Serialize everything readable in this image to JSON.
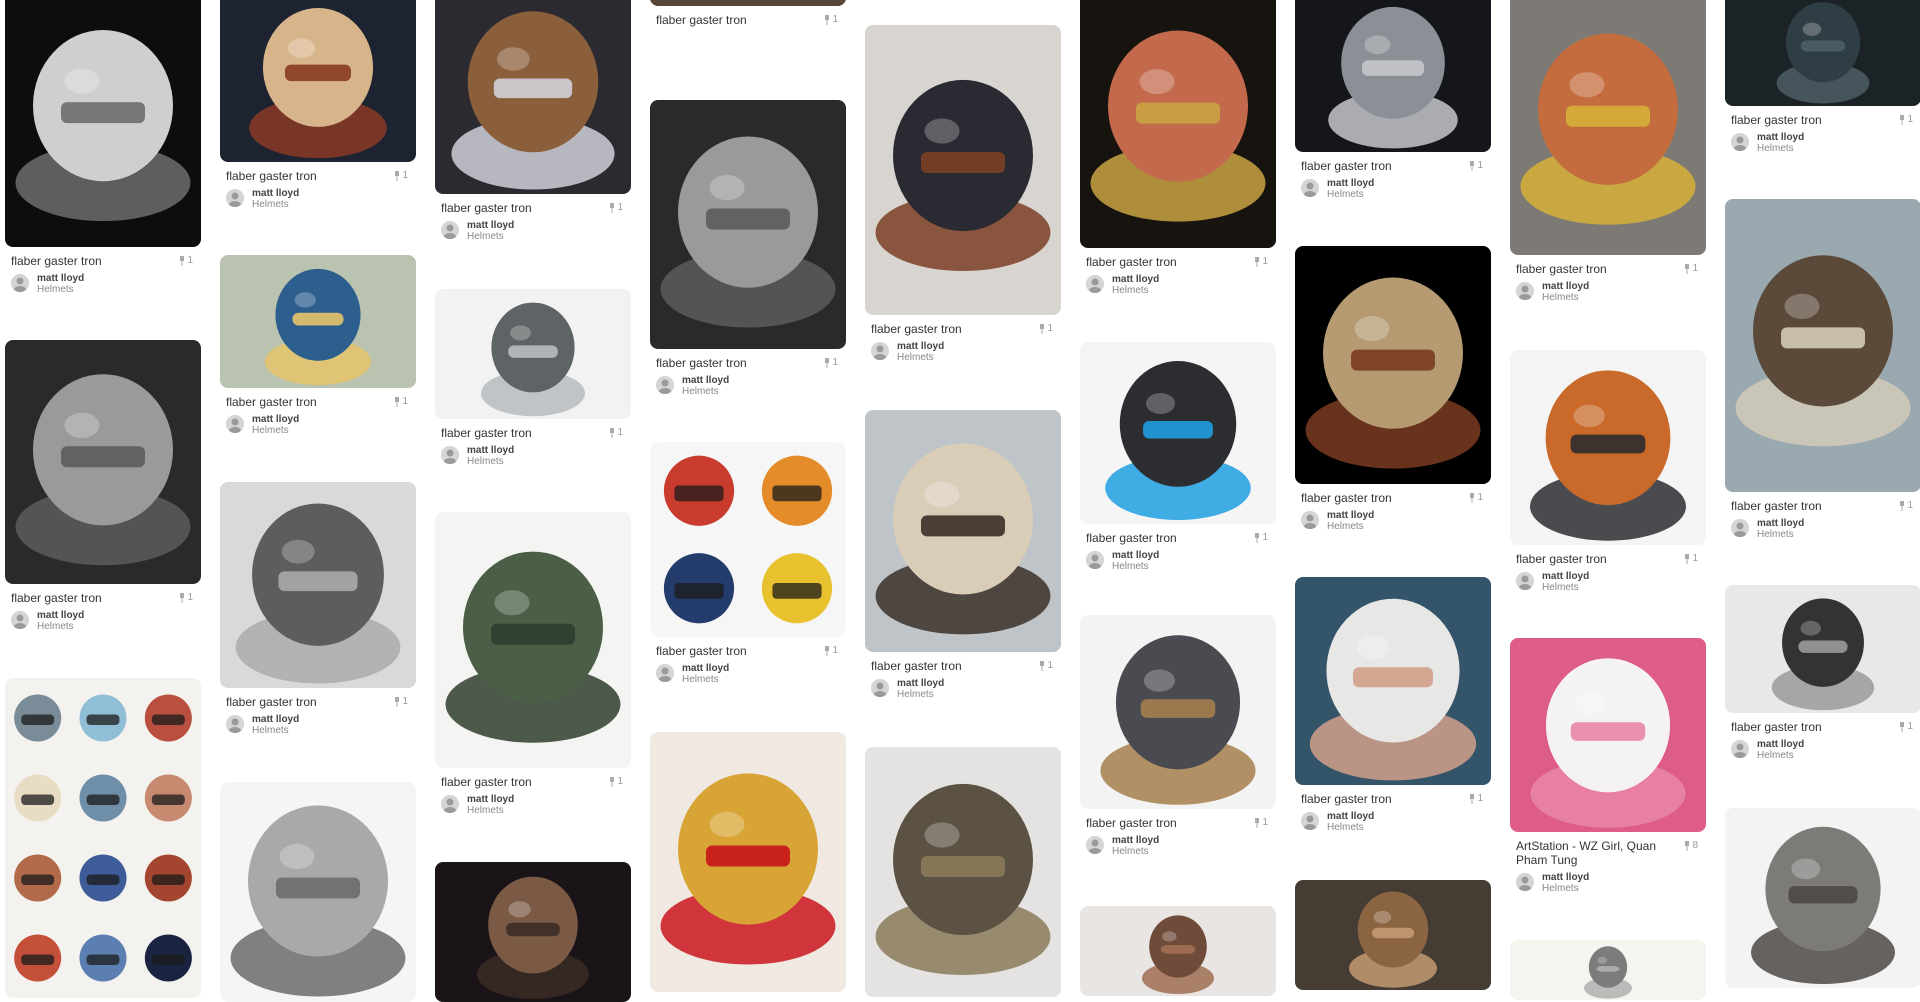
{
  "pins": [
    {
      "col": 0,
      "title": "flaber gaster tron",
      "repins": "1",
      "user": "matt lloyd",
      "board": "Helmets",
      "image": "white-masked-figure-in-suit",
      "theme": "dark-grey"
    },
    {
      "col": 0,
      "title": "flaber gaster tron",
      "repins": "1",
      "user": "matt lloyd",
      "board": "Helmets",
      "image": "gas-mask-soldier-bw",
      "theme": "bw"
    },
    {
      "col": 0,
      "title": "",
      "repins": "",
      "user": "",
      "board": "",
      "image": "robot-heads-icon-grid",
      "theme": "icons"
    },
    {
      "col": 1,
      "title": "flaber gaster tron",
      "repins": "1",
      "user": "matt lloyd",
      "board": "Helmets",
      "image": "tibetan-skull-mask",
      "theme": "tibetan"
    },
    {
      "col": 1,
      "title": "flaber gaster tron",
      "repins": "1",
      "user": "matt lloyd",
      "board": "Helmets",
      "image": "feathered-bird-helmet",
      "theme": "feather"
    },
    {
      "col": 1,
      "title": "flaber gaster tron",
      "repins": "1",
      "user": "matt lloyd",
      "board": "Helmets",
      "image": "pilot-in-cockpit-bw",
      "theme": "bw-light"
    },
    {
      "col": 1,
      "title": "",
      "repins": "",
      "user": "",
      "board": "",
      "image": "knight-armor-with-spear",
      "theme": "armor-light"
    },
    {
      "col": 2,
      "title": "flaber gaster tron",
      "repins": "1",
      "user": "matt lloyd",
      "board": "Helmets",
      "image": "boots-on-seated-figure",
      "theme": "boots"
    },
    {
      "col": 2,
      "title": "flaber gaster tron",
      "repins": "1",
      "user": "matt lloyd",
      "board": "Helmets",
      "image": "grey-open-face-helmet",
      "theme": "grey-helmet"
    },
    {
      "col": 2,
      "title": "flaber gaster tron",
      "repins": "1",
      "user": "matt lloyd",
      "board": "Helmets",
      "image": "green-gladiator-helmet",
      "theme": "green-helmet"
    },
    {
      "col": 2,
      "title": "",
      "repins": "",
      "user": "",
      "board": "",
      "image": "rusty-iron-helmet",
      "theme": "rust-dark"
    },
    {
      "col": 3,
      "title": "flaber gaster tron",
      "repins": "1",
      "user": "",
      "board": "",
      "image": "top-cropped-photo",
      "theme": "brown"
    },
    {
      "col": 3,
      "title": "flaber gaster tron",
      "repins": "1",
      "user": "matt lloyd",
      "board": "Helmets",
      "image": "aviator-with-goggles-bw",
      "theme": "bw"
    },
    {
      "col": 3,
      "title": "flaber gaster tron",
      "repins": "1",
      "user": "matt lloyd",
      "board": "Helmets",
      "image": "four-racing-helmets",
      "theme": "racing"
    },
    {
      "col": 3,
      "title": "",
      "repins": "",
      "user": "",
      "board": "",
      "image": "golden-corinthian-helmet",
      "theme": "gold"
    },
    {
      "col": 4,
      "title": "flaber gaster tron",
      "repins": "1",
      "user": "matt lloyd",
      "board": "Helmets",
      "image": "tribal-feather-headdress",
      "theme": "tribal"
    },
    {
      "col": 4,
      "title": "flaber gaster tron",
      "repins": "1",
      "user": "matt lloyd",
      "board": "Helmets",
      "image": "festival-mask-with-fur",
      "theme": "festival"
    },
    {
      "col": 4,
      "title": "",
      "repins": "",
      "user": "",
      "board": "",
      "image": "bronze-greek-helmet",
      "theme": "bronze"
    },
    {
      "col": 5,
      "title": "flaber gaster tron",
      "repins": "1",
      "user": "matt lloyd",
      "board": "Helmets",
      "image": "tibetan-crowned-demon-mask",
      "theme": "demon"
    },
    {
      "col": 5,
      "title": "flaber gaster tron",
      "repins": "1",
      "user": "matt lloyd",
      "board": "Helmets",
      "image": "black-scifi-helmet-blue-ring",
      "theme": "scifi"
    },
    {
      "col": 5,
      "title": "flaber gaster tron",
      "repins": "1",
      "user": "matt lloyd",
      "board": "Helmets",
      "image": "samurai-kabuto",
      "theme": "samurai"
    },
    {
      "col": 5,
      "title": "",
      "repins": "",
      "user": "",
      "board": "",
      "image": "leather-helmet",
      "theme": "leather"
    },
    {
      "col": 6,
      "title": "flaber gaster tron",
      "repins": "1",
      "user": "matt lloyd",
      "board": "Helmets",
      "image": "ornate-silver-skull",
      "theme": "silver-skull"
    },
    {
      "col": 6,
      "title": "flaber gaster tron",
      "repins": "1",
      "user": "matt lloyd",
      "board": "Helmets",
      "image": "tribal-wooden-mask",
      "theme": "tribal-dark"
    },
    {
      "col": 6,
      "title": "flaber gaster tron",
      "repins": "1",
      "user": "matt lloyd",
      "board": "Helmets",
      "image": "astronaut-portrait",
      "theme": "astronaut"
    },
    {
      "col": 6,
      "title": "",
      "repins": "",
      "user": "",
      "board": "",
      "image": "bronze-helmet-dark",
      "theme": "bronze-dark"
    },
    {
      "col": 7,
      "title": "flaber gaster tron",
      "repins": "1",
      "user": "matt lloyd",
      "board": "Helmets",
      "image": "masked-dancers",
      "theme": "dancers"
    },
    {
      "col": 7,
      "title": "flaber gaster tron",
      "repins": "1",
      "user": "matt lloyd",
      "board": "Helmets",
      "image": "orange-scooter-helmet",
      "theme": "orange-helmet"
    },
    {
      "col": 7,
      "title": "ArtStation - WZ Girl, Quan Pham Tung",
      "repins": "8",
      "user": "matt lloyd",
      "board": "Helmets",
      "image": "cute-girl-white-helmet-pink",
      "theme": "pink"
    },
    {
      "col": 7,
      "title": "",
      "repins": "",
      "user": "",
      "board": "",
      "image": "helmet-sketch-sheet",
      "theme": "sketch"
    },
    {
      "col": 8,
      "title": "flaber gaster tron",
      "repins": "1",
      "user": "matt lloyd",
      "board": "Helmets",
      "image": "dark-figure-legs",
      "theme": "dark-blue"
    },
    {
      "col": 8,
      "title": "flaber gaster tron",
      "repins": "1",
      "user": "matt lloyd",
      "board": "Helmets",
      "image": "deep-sea-diver-at-harbor",
      "theme": "diver"
    },
    {
      "col": 8,
      "title": "flaber gaster tron",
      "repins": "1",
      "user": "matt lloyd",
      "board": "Helmets",
      "image": "astronaut-figures-bw",
      "theme": "bw-astro"
    },
    {
      "col": 8,
      "title": "",
      "repins": "",
      "user": "",
      "board": "",
      "image": "steel-armet-helmet",
      "theme": "steel"
    }
  ],
  "colors": {
    "title": "#333333",
    "meta": "#999999",
    "user": "#444444",
    "board": "#888888"
  }
}
